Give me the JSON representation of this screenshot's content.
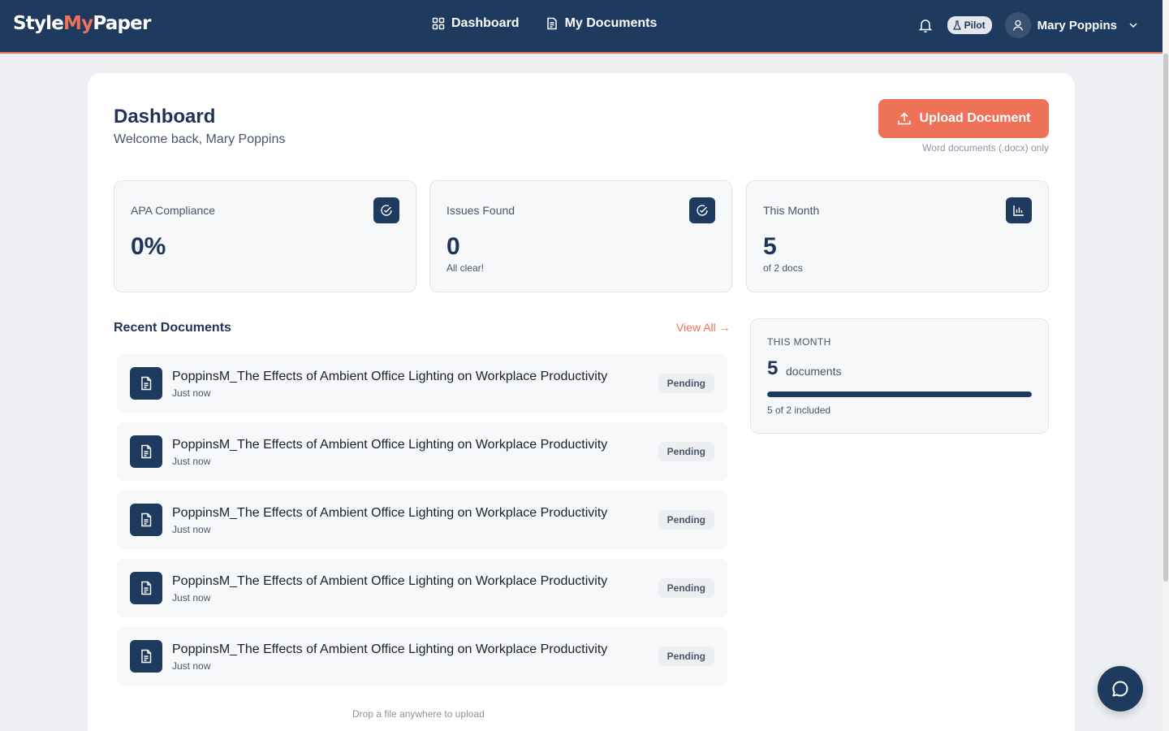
{
  "brand": {
    "part1": "Style",
    "part2": "My",
    "part3": "Paper"
  },
  "nav": {
    "dashboard_label": "Dashboard",
    "documents_label": "My Documents",
    "badge": "Pilot",
    "user_name": "Mary Poppins"
  },
  "header": {
    "title": "Dashboard",
    "welcome": "Welcome back, Mary Poppins",
    "upload_label": "Upload Document",
    "upload_note": "Word documents (.docx) only"
  },
  "stats": [
    {
      "label": "APA Compliance",
      "value": "0%",
      "sub": "",
      "icon": "check-circle-icon"
    },
    {
      "label": "Issues Found",
      "value": "0",
      "sub": "All clear!",
      "icon": "check-circle-icon"
    },
    {
      "label": "This Month",
      "value": "5",
      "sub": "of 2 docs",
      "icon": "bar-chart-icon"
    }
  ],
  "recent": {
    "title": "Recent Documents",
    "view_all": "View All →",
    "documents": [
      {
        "name": "PoppinsM_The Effects of Ambient Office Lighting on Workplace Productivity",
        "time": "Just now",
        "status": "Pending"
      },
      {
        "name": "PoppinsM_The Effects of Ambient Office Lighting on Workplace Productivity",
        "time": "Just now",
        "status": "Pending"
      },
      {
        "name": "PoppinsM_The Effects of Ambient Office Lighting on Workplace Productivity",
        "time": "Just now",
        "status": "Pending"
      },
      {
        "name": "PoppinsM_The Effects of Ambient Office Lighting on Workplace Productivity",
        "time": "Just now",
        "status": "Pending"
      },
      {
        "name": "PoppinsM_The Effects of Ambient Office Lighting on Workplace Productivity",
        "time": "Just now",
        "status": "Pending"
      }
    ],
    "drop_hint": "Drop a file anywhere to upload"
  },
  "month_panel": {
    "label": "THIS MONTH",
    "count": "5",
    "unit": "documents",
    "included": "5 of 2 included",
    "progress_fraction": 1.0
  },
  "colors": {
    "navy": "#1f3a5f",
    "accent": "#ee7257",
    "background": "#eef0f3"
  }
}
